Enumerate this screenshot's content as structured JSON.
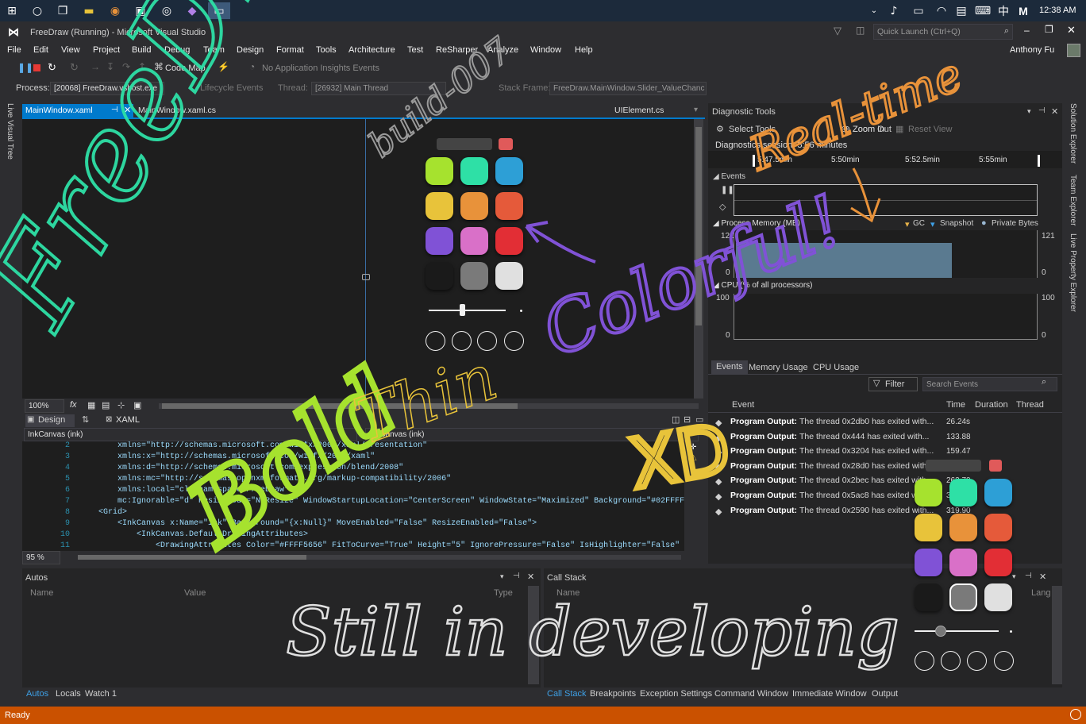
{
  "taskbar": {
    "time": "12:38 AM",
    "ime_label": "M"
  },
  "window": {
    "title": "FreeDraw (Running) - Microsoft Visual Studio",
    "quick_launch_placeholder": "Quick Launch (Ctrl+Q)",
    "user": "Anthony Fu"
  },
  "menu": [
    "File",
    "Edit",
    "View",
    "Project",
    "Build",
    "Debug",
    "Team",
    "Design",
    "Format",
    "Tools",
    "Architecture",
    "Test",
    "ReSharper",
    "Analyze",
    "Window",
    "Help"
  ],
  "toolbar": {
    "code_map": "Code Map",
    "insights": "No Application Insights Events"
  },
  "debugbar": {
    "process_label": "Process:",
    "process_value": "[20068] FreeDraw.vshost.exe",
    "lifecycle": "Lifecycle Events",
    "thread_label": "Thread:",
    "thread_value": "[26932] Main Thread",
    "stack_label": "Stack Frame:",
    "stack_value": "FreeDraw.MainWindow.Slider_ValueChanc"
  },
  "left_sidebar": {
    "live_visual_tree": "Live Visual Tree"
  },
  "right_sidebar": {
    "solution_explorer": "Solution Explorer",
    "team_explorer": "Team Explorer",
    "live_property_explorer": "Live Property Explorer"
  },
  "doc_tabs": {
    "active": "MainWindow.xaml",
    "second": "MainWindow.xaml.cs",
    "third": "UIElement.cs"
  },
  "designer": {
    "zoom": "100%",
    "design_tab": "Design",
    "xaml_tab": "XAML",
    "left_combo": "InkCanvas (ink)",
    "right_combo": "InkCanvas (ink)",
    "code_zoom": "95 %"
  },
  "code_lines": [
    {
      "num": "2",
      "indent": "        ",
      "text": "xmlns=\"http://schemas.microsoft.com/winfx/2006/xaml/presentation\""
    },
    {
      "num": "3",
      "indent": "        ",
      "text": "xmlns:x=\"http://schemas.microsoft.com/winfx/2006/xaml\""
    },
    {
      "num": "4",
      "indent": "        ",
      "text": "xmlns:d=\"http://schemas.microsoft.com/expression/blend/2008\""
    },
    {
      "num": "5",
      "indent": "        ",
      "text": "xmlns:mc=\"http://schemas.openxmlformats.org/markup-compatibility/2006\""
    },
    {
      "num": "6",
      "indent": "        ",
      "text": "xmlns:local=\"clr-namespace:FreeDraw\""
    },
    {
      "num": "7",
      "indent": "        ",
      "text": "mc:Ignorable=\"d\" ResizeMode=\"NoResize\" WindowStartupLocation=\"CenterScreen\" WindowState=\"Maximized\" Background=\"#02FFFFFF\""
    },
    {
      "num": "8",
      "indent": "    ",
      "text": "<Grid>"
    },
    {
      "num": "9",
      "indent": "        ",
      "text": "<InkCanvas x:Name=\"ink\" Background=\"{x:Null}\" MoveEnabled=\"False\" ResizeEnabled=\"False\">"
    },
    {
      "num": "10",
      "indent": "            ",
      "text": "<InkCanvas.DefaultDrawingAttributes>"
    },
    {
      "num": "11",
      "indent": "                ",
      "text": "<DrawingAttributes Color=\"#FFFF5656\" FitToCurve=\"True\" Height=\"5\" IgnorePressure=\"False\" IsHighlighter=\"False\" S"
    }
  ],
  "diagnostics": {
    "title": "Diagnostic Tools",
    "select_tools": "Select Tools",
    "zoom_in": "Zoom In",
    "zoom_out": "Zoom Out",
    "reset_view": "Reset View",
    "session": "Diagnostics session: 5:56 minutes",
    "timeline": [
      "5:47.5min",
      "5:50min",
      "5:52.5min",
      "5:55min"
    ],
    "events_label": "Events",
    "memory_label": "Process Memory (MB)",
    "legend": {
      "gc": "GC",
      "snapshot": "Snapshot",
      "private_bytes": "Private Bytes"
    },
    "memory_max_left": "121",
    "memory_max_right": "121",
    "memory_min_left": "0",
    "memory_min_right": "0",
    "cpu_label": "CPU (% of all processors)",
    "cpu_max_left": "100",
    "cpu_max_right": "100",
    "cpu_min_left": "0",
    "cpu_min_right": "0",
    "tabs": [
      "Events",
      "Memory Usage",
      "CPU Usage"
    ],
    "filter": "Filter",
    "search_placeholder": "Search Events",
    "columns": [
      "Event",
      "Time",
      "Duration",
      "Thread"
    ],
    "rows": [
      {
        "label": "Program Output:",
        "text": "The thread 0x2db0 has exited with...",
        "time": "26.24s"
      },
      {
        "label": "Program Output:",
        "text": "The thread 0x444 has exited with...",
        "time": "133.88"
      },
      {
        "label": "Program Output:",
        "text": "The thread 0x3204 has exited with...",
        "time": "159.47"
      },
      {
        "label": "Program Output:",
        "text": "The thread 0x28d0 has exited with...",
        "time": "218.72"
      },
      {
        "label": "Program Output:",
        "text": "The thread 0x2bec has exited with...",
        "time": "262.70"
      },
      {
        "label": "Program Output:",
        "text": "The thread 0x5ac8 has exited with...",
        "time": "315.08"
      },
      {
        "label": "Program Output:",
        "text": "The thread 0x2590 has exited with...",
        "time": "319.90"
      }
    ]
  },
  "autos": {
    "title": "Autos",
    "col_name": "Name",
    "col_value": "Value",
    "col_type": "Type",
    "tabs": [
      "Autos",
      "Locals",
      "Watch 1"
    ]
  },
  "callstack": {
    "title": "Call Stack",
    "col_name": "Name",
    "col_lang": "Lang",
    "tabs": [
      "Call Stack",
      "Breakpoints",
      "Exception Settings",
      "Command Window",
      "Immediate Window",
      "Output"
    ]
  },
  "status": {
    "text": "Ready"
  },
  "palette": {
    "colors": [
      "#a6e22e",
      "#2ee0a6",
      "#2d9fd6",
      "#e8c33a",
      "#e8923a",
      "#e55a3a",
      "#8052d6",
      "#d970c8",
      "#e22e35",
      "#1a1a1a",
      "#7a7a7a",
      "#e0e0e0"
    ],
    "top_swatch": "#e05a5a",
    "bar_color": "#444444"
  },
  "ink_words": {
    "freedraw": "FreeDraw",
    "build": "build-007",
    "realtime": "Real-time",
    "colorful": "Colorful!",
    "bold": "Bold",
    "thin": "Thin",
    "xd": "XD",
    "still": "Still in developing"
  }
}
